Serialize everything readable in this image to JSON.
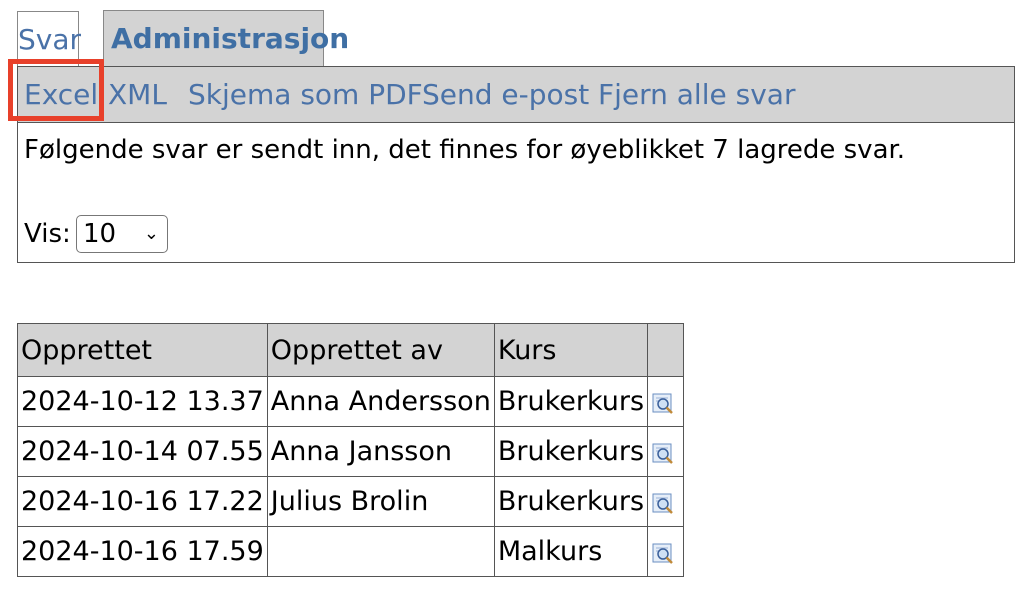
{
  "tabs": [
    {
      "label": "Svar"
    },
    {
      "label": "Administrasjon"
    }
  ],
  "toolbar": {
    "excel": "Excel",
    "xml": "XML",
    "pdf": "Skjema som PDF",
    "email": "Send e-post",
    "remove": "Fjern alle svar"
  },
  "info_text": "Følgende svar er sendt inn, det finnes for øyeblikket 7 lagrede svar.",
  "vis": {
    "label": "Vis:",
    "value": "10"
  },
  "table": {
    "headers": [
      "Opprettet",
      "Opprettet av",
      "Kurs",
      ""
    ],
    "rows": [
      {
        "created": "2024-10-12 13.37",
        "by": "Anna Andersson",
        "course": "Brukerkurs"
      },
      {
        "created": "2024-10-14 07.55",
        "by": "Anna Jansson",
        "course": "Brukerkurs"
      },
      {
        "created": "2024-10-16 17.22",
        "by": "Julius Brolin",
        "course": "Brukerkurs"
      },
      {
        "created": "2024-10-16 17.59",
        "by": "",
        "course": "Malkurs"
      }
    ]
  },
  "colors": {
    "link": "#4a72a8",
    "highlight": "#e8402a",
    "toolbar_bg": "#d3d3d3"
  }
}
